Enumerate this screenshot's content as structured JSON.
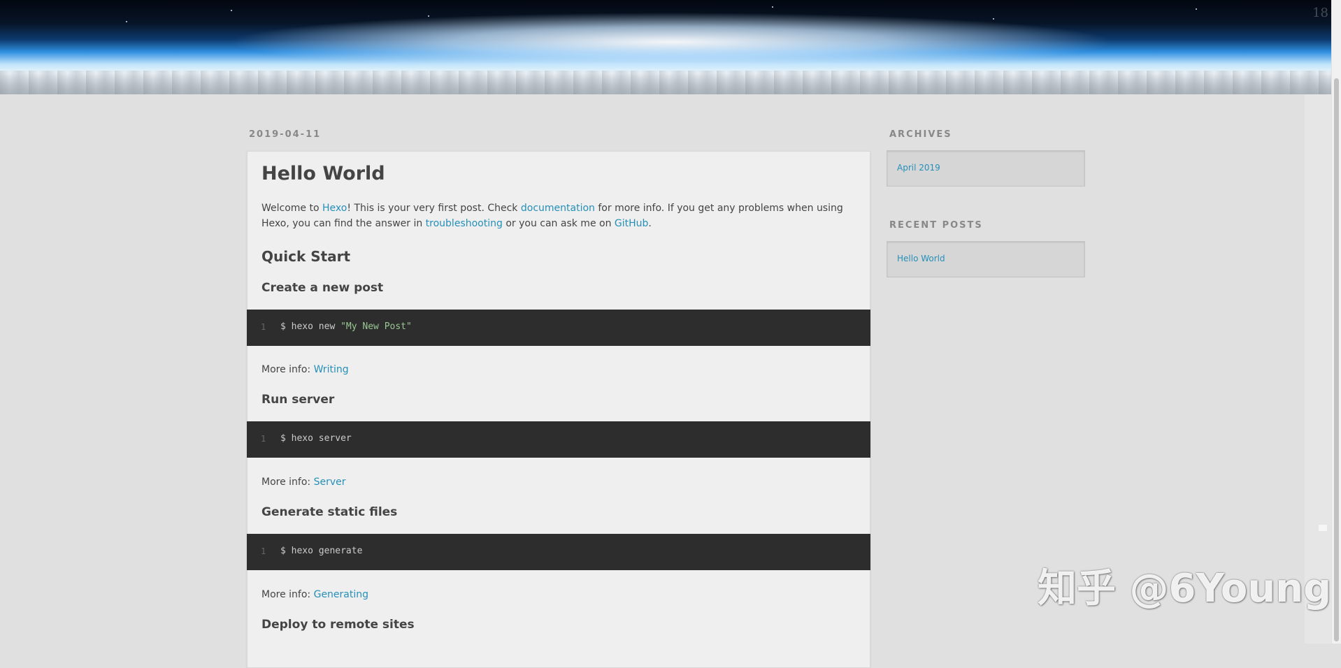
{
  "banner": {
    "corner_number": "18"
  },
  "post": {
    "date": "2019-04-11",
    "title": "Hello World",
    "intro": {
      "t1": "Welcome to ",
      "l1": "Hexo",
      "t2": "! This is your very first post. Check ",
      "l2": "documentation",
      "t3": " for more info. If you get any problems when using Hexo, you can find the answer in ",
      "l3": "troubleshooting",
      "t4": " or you can ask me on ",
      "l4": "GitHub",
      "t5": "."
    },
    "quick_start": "Quick Start",
    "sections": [
      {
        "heading": "Create a new post",
        "line_no": "1",
        "cmd": "$ hexo new ",
        "cmd_str": "\"My New Post\"",
        "more_label": "More info: ",
        "more_link": "Writing"
      },
      {
        "heading": "Run server",
        "line_no": "1",
        "cmd": "$ hexo server",
        "more_label": "More info: ",
        "more_link": "Server"
      },
      {
        "heading": "Generate static files",
        "line_no": "1",
        "cmd": "$ hexo generate",
        "more_label": "More info: ",
        "more_link": "Generating"
      },
      {
        "heading": "Deploy to remote sites"
      }
    ]
  },
  "sidebar": {
    "archives": {
      "title": "ARCHIVES",
      "items": [
        "April 2019"
      ]
    },
    "recent_posts": {
      "title": "RECENT POSTS",
      "items": [
        "Hello World"
      ]
    }
  },
  "watermark": "知乎 @6Young",
  "colors": {
    "link": "#258fb8",
    "code_bg": "#2d2d2d",
    "page_bg": "#e0e0e0",
    "article_bg": "#efefef"
  }
}
